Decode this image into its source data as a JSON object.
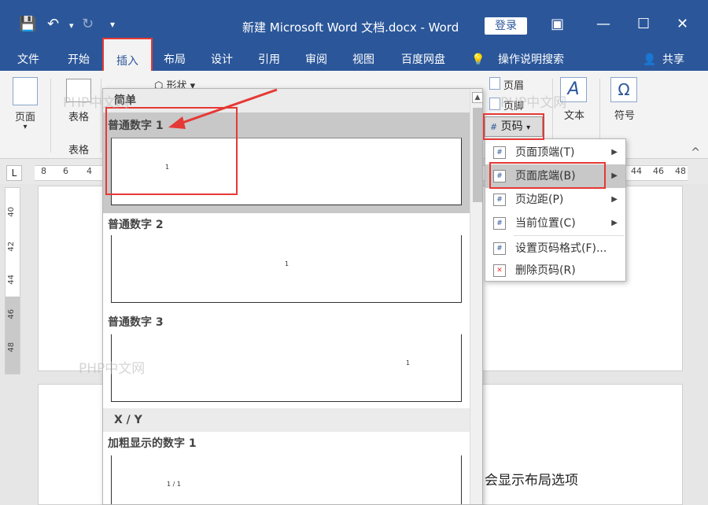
{
  "title_bar": {
    "title": "新建 Microsoft Word 文档.docx  -  Word",
    "login": "登录",
    "save_icon": "save-icon",
    "undo_icon": "undo-icon",
    "redo_icon": "redo-icon",
    "customize_icon": "customize-icon"
  },
  "tabs": [
    {
      "label": "文件"
    },
    {
      "label": "开始"
    },
    {
      "label": "插入"
    },
    {
      "label": "布局"
    },
    {
      "label": "设计"
    },
    {
      "label": "引用"
    },
    {
      "label": "审阅"
    },
    {
      "label": "视图"
    },
    {
      "label": "百度网盘"
    },
    {
      "label": "操作说明搜索"
    },
    {
      "label": "共享"
    }
  ],
  "ribbon": {
    "page_label": "页面",
    "table_label": "表格",
    "table_group": "表格",
    "shapes_label": "形状",
    "header_label": "页眉",
    "footer_label": "页脚",
    "page_number_label": "页码",
    "text_label": "文本",
    "symbol_label": "符号",
    "symbol_glyph": "Ω",
    "text_glyph": "A",
    "collapse_glyph": "^"
  },
  "ruler": {
    "corner": "L",
    "left_nums": [
      "8",
      "6",
      "4"
    ],
    "right_nums": [
      "44",
      "46",
      "48"
    ],
    "vertical_nums": [
      "40",
      "42",
      "44",
      "46",
      "48"
    ]
  },
  "gallery": {
    "section_simple": "简单",
    "items": [
      {
        "label": "普通数字 1",
        "preview": "1"
      },
      {
        "label": "普通数字 2",
        "preview": "1"
      },
      {
        "label": "普通数字 3",
        "preview": "1"
      }
    ],
    "section_xy": "X / Y",
    "bold_item": {
      "label": "加粗显示的数字 1",
      "preview": "1 / 1"
    }
  },
  "page_number_menu": {
    "button": "页码",
    "items": [
      {
        "label": "页面顶端(T)",
        "submenu": true
      },
      {
        "label": "页面底端(B)",
        "submenu": true
      },
      {
        "label": "页边距(P)",
        "submenu": true
      },
      {
        "label": "当前位置(C)",
        "submenu": true
      },
      {
        "label": "设置页码格式(F)...",
        "submenu": false
      },
      {
        "label": "删除页码(R)",
        "submenu": false
      }
    ]
  },
  "document": {
    "text": "会显示布局选项"
  },
  "watermark": "PHP中文网"
}
